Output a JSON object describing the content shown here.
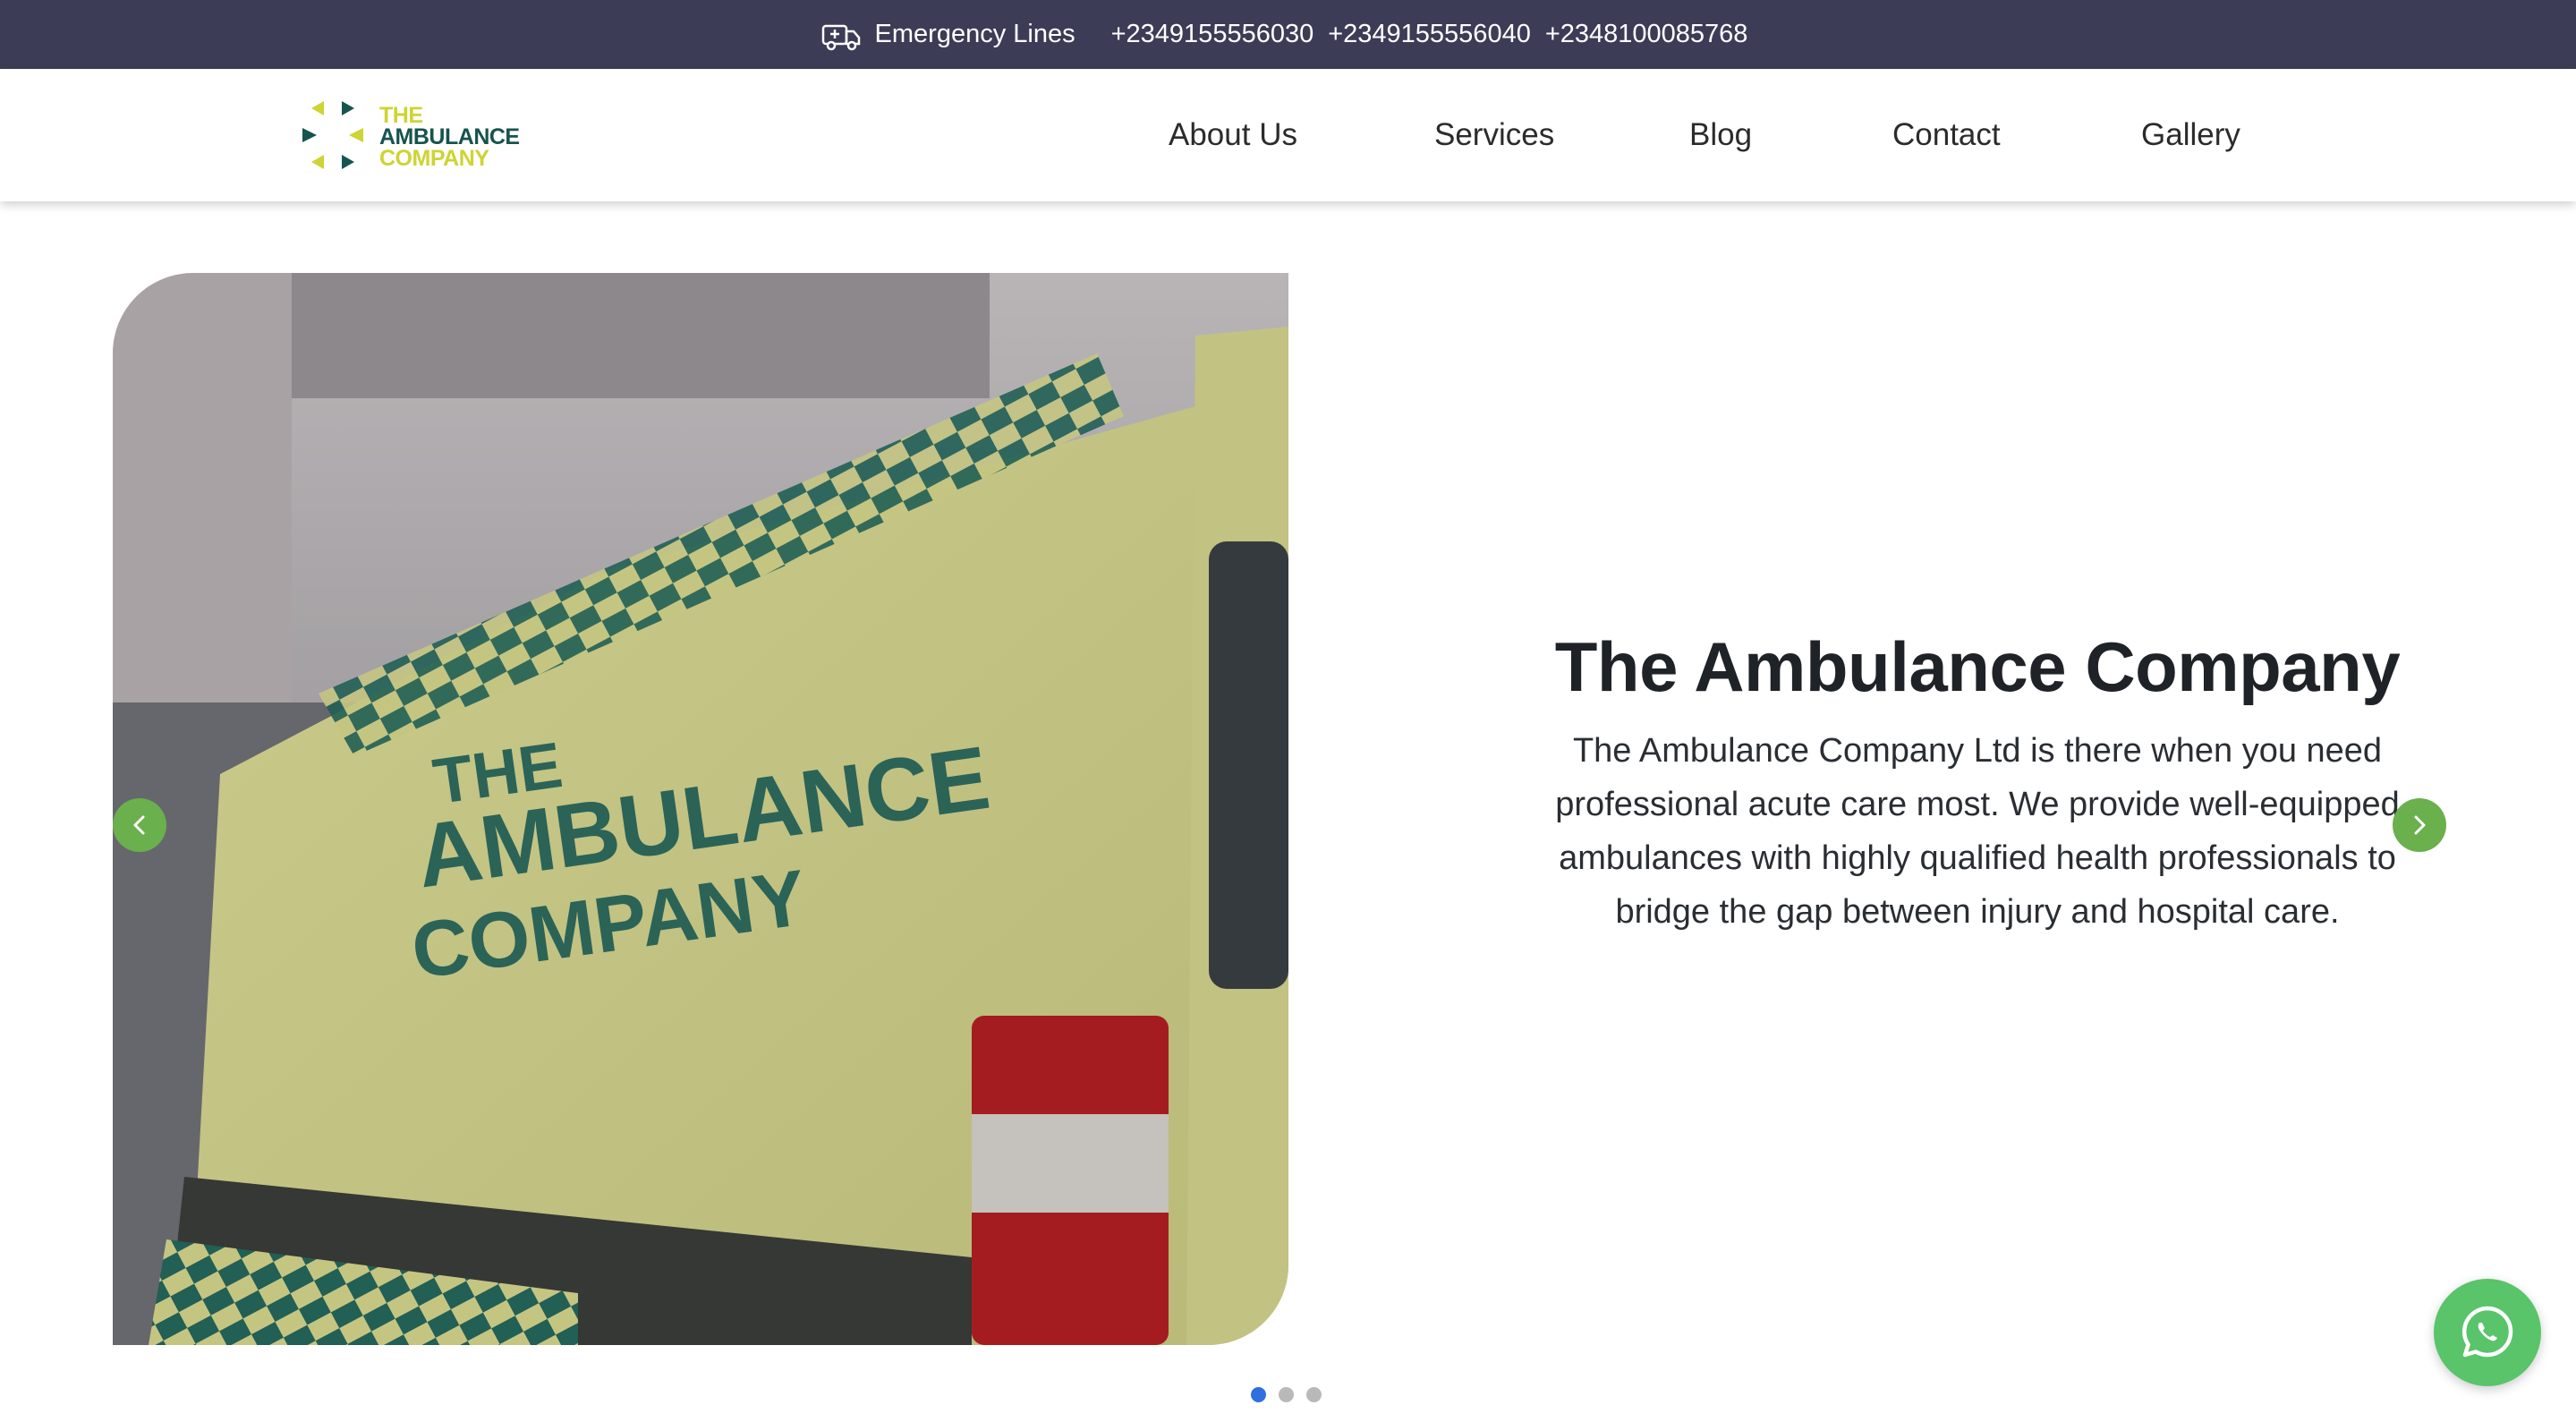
{
  "topbar": {
    "label": "Emergency Lines",
    "icon": "ambulance-icon",
    "phones": [
      "+2349155556030",
      "+2349155556040",
      "+2348100085768"
    ]
  },
  "logo": {
    "line1": "THE",
    "line2": "AMBULANCE",
    "line3": "COMPANY",
    "colors": {
      "green": "#cdd433",
      "dark": "#17534f"
    }
  },
  "nav": {
    "items": [
      {
        "label": "About Us"
      },
      {
        "label": "Services"
      },
      {
        "label": "Blog"
      },
      {
        "label": "Contact"
      },
      {
        "label": "Gallery"
      }
    ]
  },
  "hero": {
    "title": "The Ambulance Company",
    "description": "The Ambulance Company Ltd is there when you need professional acute care most. We provide well-equipped ambulances with highly qualified health professionals to bridge the gap between injury and hospital care.",
    "image_text": {
      "line1": "THE",
      "line2": "AMBULANCE",
      "line3": "COMPANY"
    },
    "prev_icon": "chevron-left-icon",
    "next_icon": "chevron-right-icon"
  },
  "carousel": {
    "slides": 3,
    "active": 1
  },
  "whatsapp": {
    "icon": "whatsapp-icon"
  },
  "colors": {
    "topbar_bg": "#3d3c57",
    "arrow_bg": "#6ab04c",
    "whatsapp_bg": "#59c46a",
    "dot_active": "#2f6fe0"
  }
}
